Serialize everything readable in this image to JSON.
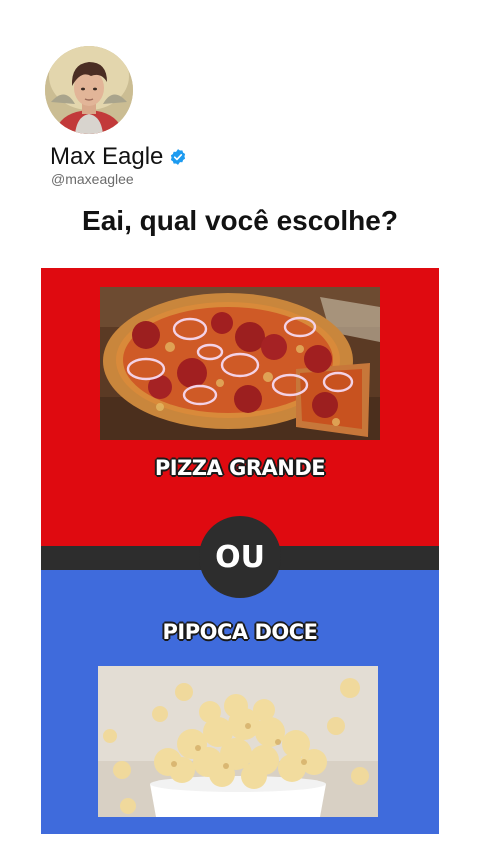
{
  "profile": {
    "name": "Max Eagle",
    "handle": "@maxeaglee",
    "verified": true,
    "avatar_icon": "avatar-photo"
  },
  "post": {
    "question": "Eai, qual você escolhe?"
  },
  "poll": {
    "option_a": {
      "label": "PIZZA GRANDE",
      "image": "pizza-photo",
      "background": "#df0a10"
    },
    "separator": "OU",
    "option_b": {
      "label": "PIPOCA DOCE",
      "image": "popcorn-photo",
      "background": "#3f6bdc"
    }
  },
  "colors": {
    "verified_badge": "#1d9bf0",
    "divider": "#2d2d2d"
  }
}
